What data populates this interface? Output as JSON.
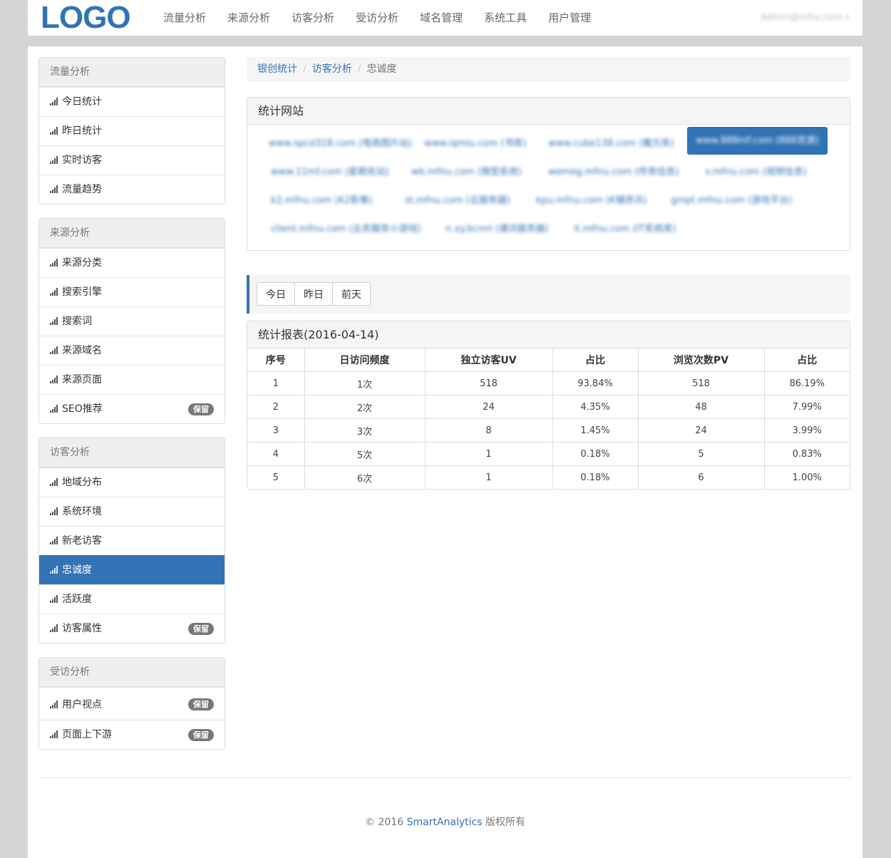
{
  "brand": {
    "logo": "LOGO",
    "color": "#3273b5"
  },
  "topnav": [
    "流量分析",
    "来源分析",
    "访客分析",
    "受访分析",
    "域名管理",
    "系统工具",
    "用户管理"
  ],
  "user": {
    "name": "admin@mhu.com"
  },
  "sidebar": [
    {
      "title": "流量分析",
      "items": [
        {
          "label": "今日统计"
        },
        {
          "label": "昨日统计"
        },
        {
          "label": "实时访客"
        },
        {
          "label": "流量趋势"
        }
      ]
    },
    {
      "title": "来源分析",
      "items": [
        {
          "label": "来源分类"
        },
        {
          "label": "搜索引擎"
        },
        {
          "label": "搜索词"
        },
        {
          "label": "来源域名"
        },
        {
          "label": "来源页面"
        },
        {
          "label": "SEO推荐",
          "badge": "保留"
        }
      ]
    },
    {
      "title": "访客分析",
      "items": [
        {
          "label": "地域分布"
        },
        {
          "label": "系统环境"
        },
        {
          "label": "新老访客"
        },
        {
          "label": "忠诚度",
          "active": true
        },
        {
          "label": "活跃度"
        },
        {
          "label": "访客属性",
          "badge": "保留"
        }
      ]
    },
    {
      "title": "受访分析",
      "items": [
        {
          "label": "用户视点",
          "badge": "保留"
        },
        {
          "label": "页面上下游",
          "badge": "保留"
        }
      ]
    }
  ],
  "breadcrumb": {
    "root": "银创统计",
    "parent": "访客分析",
    "current": "忠诚度"
  },
  "sites_panel": {
    "title": "统计网站",
    "sites": [
      "www.spcd318.com (电商图片站)",
      "www.iqmiu.com (书库)",
      "www.cube138.com (魔方库)",
      "www.888mf.com (888资源)",
      "www.11mf.com (星期名站)",
      "wb.mfnu.com (微型系统)",
      "wemeg.mfnu.com (传奇信息)",
      "v.mfnu.com (视频信息)",
      "k2.mfnu.com (K2影像)",
      "st.mfnu.com (云服务器)",
      "kpu.mfnu.com (K铺资讯)",
      "gmpt.mfnu.com (游戏平台)",
      "client.mfnu.com (业务服务小游戏)",
      "n.xy.bcnnl (通讯服务器)",
      "it.mfnu.com (IT系统库)"
    ]
  },
  "day_buttons": [
    "今日",
    "昨日",
    "前天"
  ],
  "report": {
    "title": "统计报表(2016-04-14)",
    "columns": [
      "序号",
      "日访问频度",
      "独立访客UV",
      "占比",
      "浏览次数PV",
      "占比"
    ],
    "rows": [
      [
        "1",
        "1次",
        "518",
        "93.84%",
        "518",
        "86.19%"
      ],
      [
        "2",
        "2次",
        "24",
        "4.35%",
        "48",
        "7.99%"
      ],
      [
        "3",
        "3次",
        "8",
        "1.45%",
        "24",
        "3.99%"
      ],
      [
        "4",
        "5次",
        "1",
        "0.18%",
        "5",
        "0.83%"
      ],
      [
        "5",
        "6次",
        "1",
        "0.18%",
        "6",
        "1.00%"
      ]
    ]
  },
  "footer": {
    "copyright": "© 2016",
    "brand": "SmartAnalytics",
    "suffix": "版权所有"
  }
}
